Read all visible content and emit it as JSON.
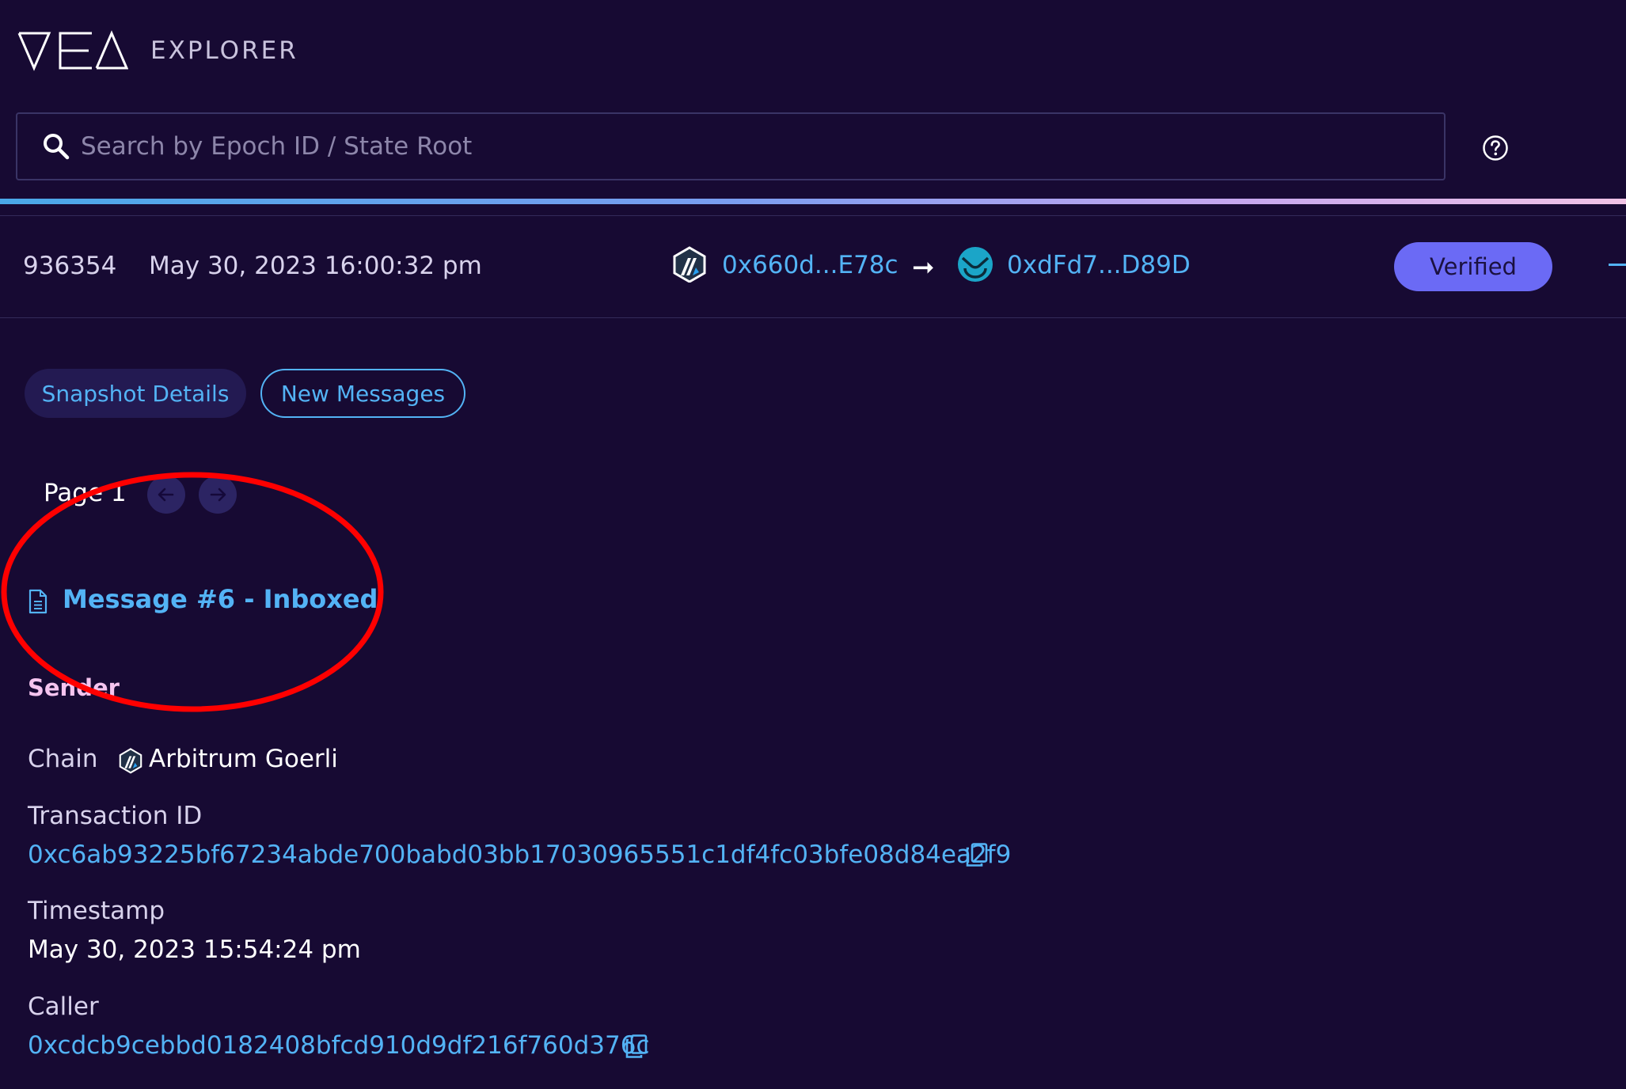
{
  "header": {
    "logo_text": "VEA",
    "explorer_label": "EXPLORER"
  },
  "search": {
    "placeholder": "Search by Epoch ID / State Root"
  },
  "snapshot_row": {
    "epoch_id": "936354",
    "date": "May 30, 2023 16:00:32 pm",
    "from_address": "0x660d...E78c",
    "from_chain_icon": "arbitrum-icon",
    "to_address": "0xdFd7...D89D",
    "to_chain_icon": "gnosis-icon",
    "arrow": "➞",
    "status": "Verified"
  },
  "tabs": [
    {
      "label": "Snapshot Details",
      "active": false
    },
    {
      "label": "New Messages",
      "active": true
    }
  ],
  "pagination": {
    "label": "Page 1"
  },
  "message": {
    "title": "Message #6 - Inboxed",
    "sender": {
      "heading": "Sender",
      "chain_label": "Chain",
      "chain_value": "Arbitrum Goerli",
      "tx_label": "Transaction ID",
      "tx_value": "0xc6ab93225bf67234abde700babd03bb17030965551c1df4fc03bfe08d84ea2f9",
      "timestamp_label": "Timestamp",
      "timestamp_value": "May 30, 2023 15:54:24 pm",
      "caller_label": "Caller",
      "caller_value": "0xcdcb9cebbd0182408bfcd910d9df216f760d376c"
    }
  },
  "colors": {
    "background": "#170a33",
    "link": "#53b3f5",
    "badge": "#6b6af5",
    "sender_heading": "#f5c4ef",
    "annotation": "#ff0000"
  }
}
